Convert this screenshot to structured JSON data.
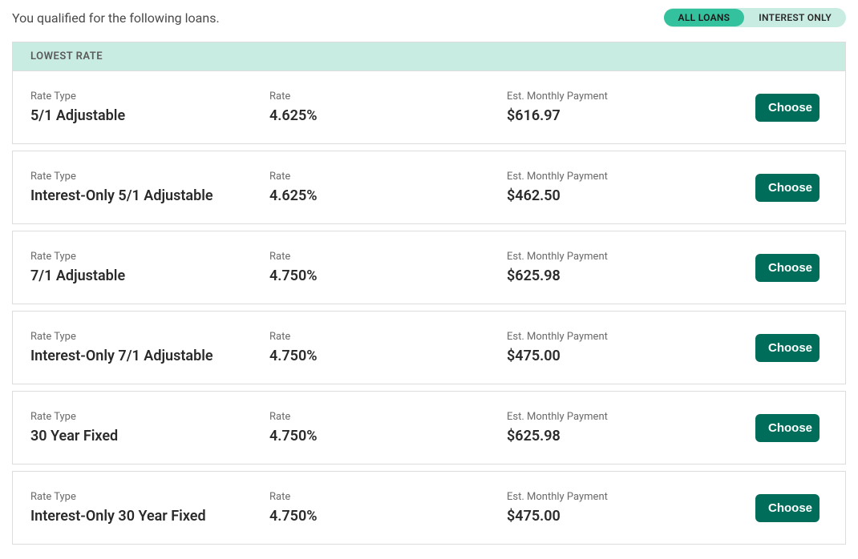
{
  "header": {
    "title": "You qualified for the following loans.",
    "toggle": {
      "options": [
        {
          "label": "ALL LOANS",
          "active": true
        },
        {
          "label": "INTEREST ONLY",
          "active": false
        }
      ]
    }
  },
  "banner": "LOWEST RATE",
  "columns": {
    "rate_type": "Rate Type",
    "rate": "Rate",
    "payment": "Est. Monthly Payment",
    "action": "Choose"
  },
  "loans": [
    {
      "type": "5/1 Adjustable",
      "rate": "4.625%",
      "payment": "$616.97"
    },
    {
      "type": "Interest-Only 5/1 Adjustable",
      "rate": "4.625%",
      "payment": "$462.50"
    },
    {
      "type": "7/1 Adjustable",
      "rate": "4.750%",
      "payment": "$625.98"
    },
    {
      "type": "Interest-Only 7/1 Adjustable",
      "rate": "4.750%",
      "payment": "$475.00"
    },
    {
      "type": "30 Year Fixed",
      "rate": "4.750%",
      "payment": "$625.98"
    },
    {
      "type": "Interest-Only 30 Year Fixed",
      "rate": "4.750%",
      "payment": "$475.00"
    }
  ]
}
